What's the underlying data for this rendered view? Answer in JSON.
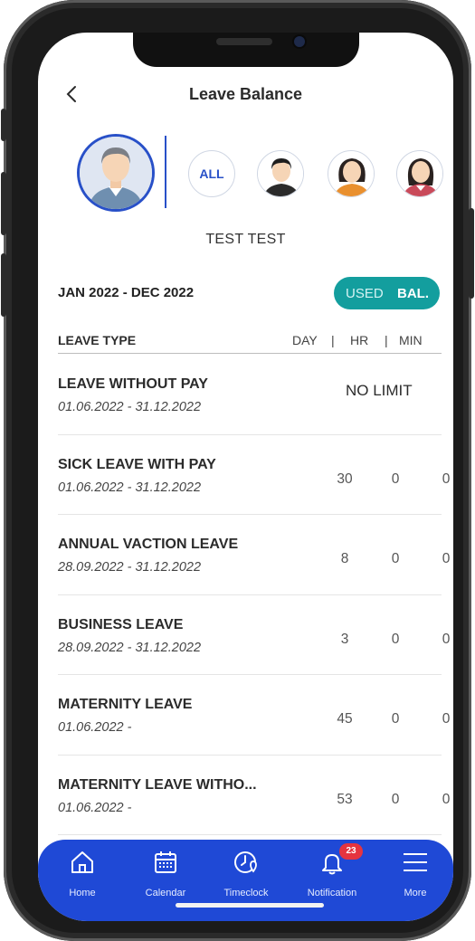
{
  "header": {
    "title": "Leave Balance"
  },
  "avatars": {
    "all_label": "ALL"
  },
  "user": {
    "name": "TEST TEST"
  },
  "period": {
    "label": "JAN 2022 - DEC 2022"
  },
  "toggle": {
    "used_label": "USED",
    "bal_label": "BAL.",
    "active": "BAL.",
    "color": "#139e9e"
  },
  "table": {
    "header": {
      "leave_type": "LEAVE TYPE",
      "day": "DAY",
      "hr": "HR",
      "min": "MIN",
      "separator": "|"
    },
    "rows": [
      {
        "name": "LEAVE WITHOUT PAY",
        "dates": "01.06.2022 - 31.12.2022",
        "limit": "NO LIMIT"
      },
      {
        "name": "SICK LEAVE WITH PAY",
        "dates": "01.06.2022 - 31.12.2022",
        "day": "30",
        "hr": "0",
        "min": "0"
      },
      {
        "name": "ANNUAL VACTION LEAVE",
        "dates": "28.09.2022 - 31.12.2022",
        "day": "8",
        "hr": "0",
        "min": "0"
      },
      {
        "name": "BUSINESS LEAVE",
        "dates": "28.09.2022 - 31.12.2022",
        "day": "3",
        "hr": "0",
        "min": "0"
      },
      {
        "name": "MATERNITY LEAVE",
        "dates": "01.06.2022 -",
        "day": "45",
        "hr": "0",
        "min": "0"
      },
      {
        "name": "MATERNITY LEAVE WITHO...",
        "dates": "01.06.2022 -",
        "day": "53",
        "hr": "0",
        "min": "0"
      }
    ]
  },
  "nav": {
    "color": "#1f49d6",
    "items": [
      {
        "label": "Home",
        "icon": "home-icon"
      },
      {
        "label": "Calendar",
        "icon": "calendar-icon"
      },
      {
        "label": "Timeclock",
        "icon": "timeclock-icon"
      },
      {
        "label": "Notification",
        "icon": "bell-icon",
        "badge": "23"
      },
      {
        "label": "More",
        "icon": "menu-icon"
      }
    ]
  }
}
